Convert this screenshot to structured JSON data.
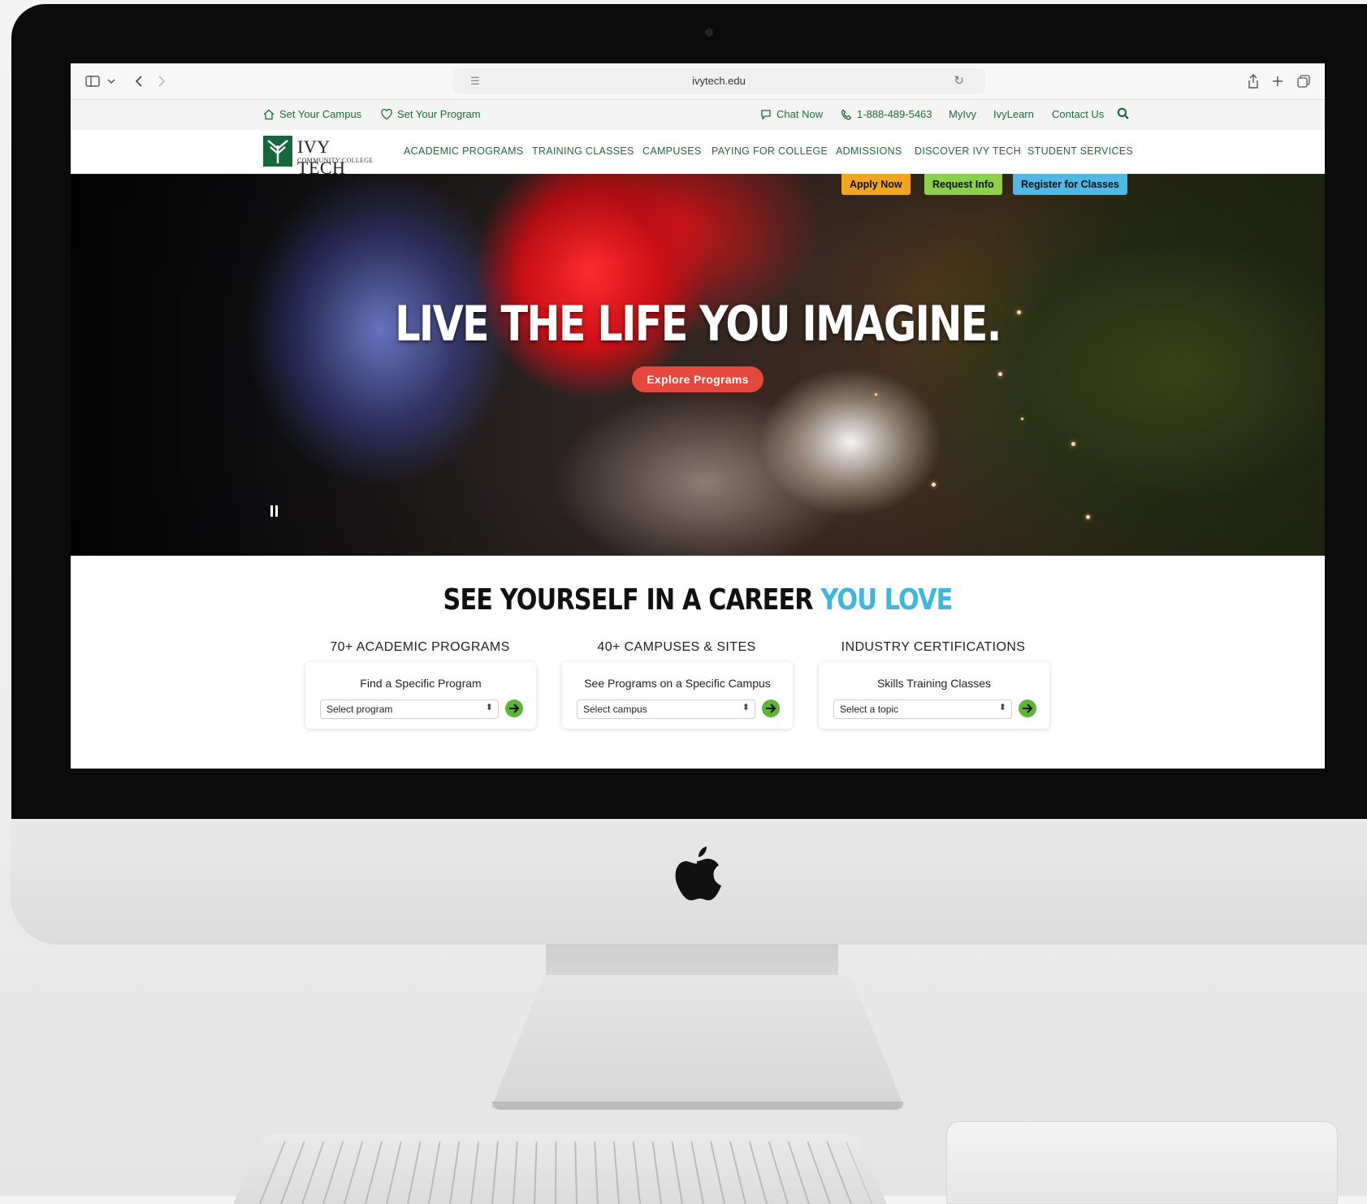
{
  "browser": {
    "url": "ivytech.edu",
    "icons": {
      "sidebar": "sidebar-icon",
      "tabs_menu": "chevron-down-icon",
      "back": "back-icon",
      "forward": "forward-icon",
      "reload": "reload-icon",
      "share": "share-icon",
      "new_tab": "plus-icon",
      "tab_overview": "tabs-icon"
    }
  },
  "utility_bar": {
    "set_campus": "Set Your Campus",
    "set_program": "Set Your Program",
    "chat": "Chat Now",
    "phone": "1-888-489-5463",
    "myivy": "MyIvy",
    "ivylearn": "IvyLearn",
    "contact": "Contact Us"
  },
  "logo": {
    "name": "IVY TECH",
    "sub": "COMMUNITY COLLEGE"
  },
  "nav": {
    "items": [
      "ACADEMIC PROGRAMS",
      "TRAINING CLASSES",
      "CAMPUSES",
      "PAYING FOR COLLEGE",
      "ADMISSIONS",
      "DISCOVER IVY TECH",
      "STUDENT SERVICES"
    ]
  },
  "cta": {
    "apply": "Apply Now",
    "request": "Request Info",
    "register": "Register for Classes"
  },
  "hero": {
    "title": "LIVE THE LIFE YOU IMAGINE.",
    "button": "Explore Programs"
  },
  "career": {
    "title_main": "SEE YOURSELF IN A CAREER ",
    "title_accent": "YOU LOVE",
    "columns": [
      {
        "heading": "70+ ACADEMIC PROGRAMS",
        "label": "Find a Specific Program",
        "select": "Select program"
      },
      {
        "heading": "40+ CAMPUSES & SITES",
        "label": "See Programs on a Specific Campus",
        "select": "Select campus"
      },
      {
        "heading": "INDUSTRY CERTIFICATIONS",
        "label": "Skills Training Classes",
        "select": "Select a topic"
      }
    ]
  },
  "colors": {
    "brand_green": "#14683a",
    "nav_green": "#1f6a3a",
    "apply": "#f4a51f",
    "request": "#8cd04b",
    "register": "#4fb8e6",
    "explore": "#e2483c",
    "accent_blue": "#3eb6e0",
    "go_green": "#5cb635"
  }
}
